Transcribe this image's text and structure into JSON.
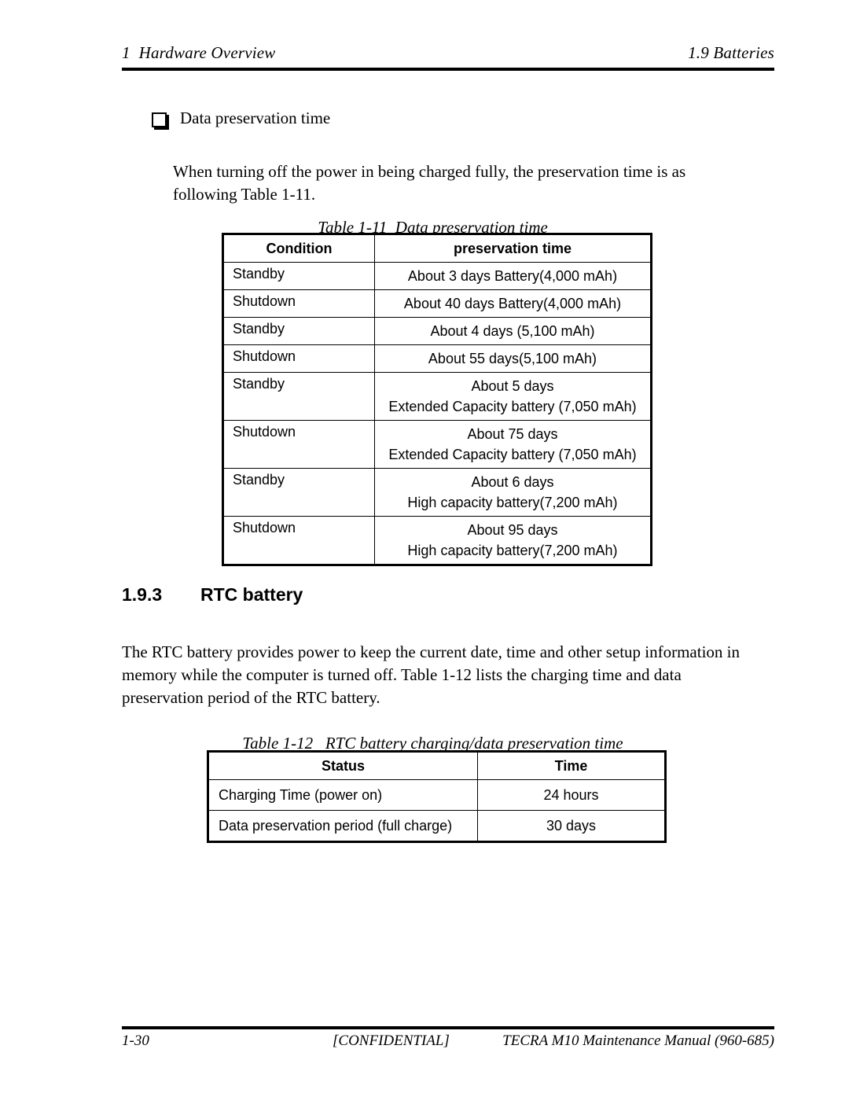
{
  "header": {
    "left": "1  Hardware Overview",
    "right": "1.9 Batteries"
  },
  "body": {
    "bullet_icon": "open-box-bullet",
    "bullet_label": "Data preservation time",
    "intro_paragraph": "When turning off the power in being charged fully, the preservation time is as following Table 1-11.",
    "section": {
      "number": "1.9.3",
      "title": "RTC battery"
    },
    "rtc_paragraph": "The RTC battery provides power to keep the current date, time and other setup information in memory while the computer is turned off. Table 1-12 lists the charging time and data preservation period of the RTC battery."
  },
  "table_1_11": {
    "caption": "Table 1-11  Data preservation time",
    "columns": [
      "Condition",
      "preservation time"
    ],
    "rows": [
      {
        "condition": "Standby",
        "value_line1": "About 3 days Battery(4,000 mAh)",
        "value_line2": ""
      },
      {
        "condition": "Shutdown",
        "value_line1": "About 40 days Battery(4,000 mAh)",
        "value_line2": ""
      },
      {
        "condition": "Standby",
        "value_line1": "About 4 days (5,100 mAh)",
        "value_line2": ""
      },
      {
        "condition": "Shutdown",
        "value_line1": "About 55 days(5,100 mAh)",
        "value_line2": ""
      },
      {
        "condition": "Standby",
        "value_line1": "About 5 days",
        "value_line2": "Extended Capacity battery (7,050 mAh)"
      },
      {
        "condition": "Shutdown",
        "value_line1": "About 75 days",
        "value_line2": "Extended Capacity battery (7,050 mAh)"
      },
      {
        "condition": "Standby",
        "value_line1": "About 6 days",
        "value_line2": "High capacity battery(7,200 mAh)"
      },
      {
        "condition": "Shutdown",
        "value_line1": "About 95 days",
        "value_line2": "High capacity battery(7,200 mAh)"
      }
    ]
  },
  "table_1_12": {
    "caption": "Table 1-12   RTC battery charging/data preservation time",
    "columns": [
      "Status",
      "Time"
    ],
    "rows": [
      {
        "status": "Charging Time (power on)",
        "time": "24 hours"
      },
      {
        "status": "Data preservation period (full charge)",
        "time": "30 days"
      }
    ]
  },
  "footer": {
    "page_number": "1-30",
    "confidential": "[CONFIDENTIAL]",
    "manual": "TECRA M10 Maintenance Manual (960-685)"
  }
}
